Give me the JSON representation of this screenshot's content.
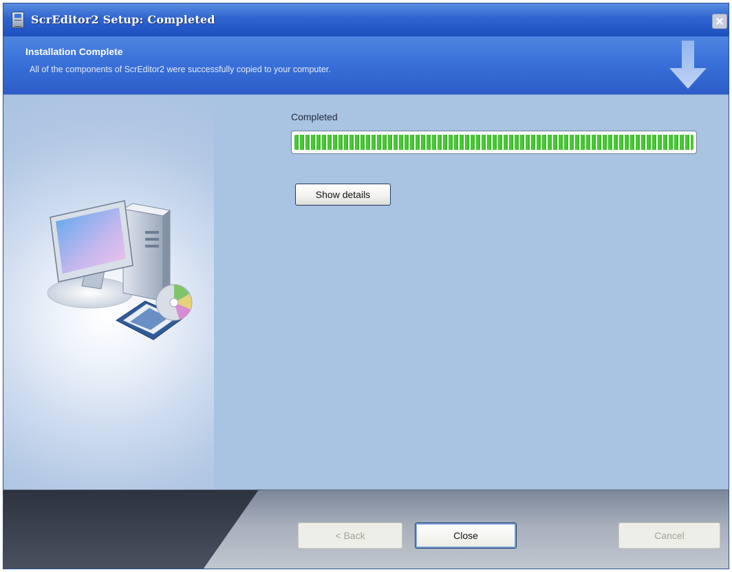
{
  "window": {
    "title": "ScrEditor2 Setup: Completed",
    "icons": {
      "app": "setup-app-icon",
      "close": "close-icon"
    }
  },
  "header": {
    "title": "Installation Complete",
    "subtitle": "All of the components of ScrEditor2 were successfully copied to your computer.",
    "icon": "download-arrow-icon"
  },
  "main": {
    "status_label": "Completed",
    "progress_percent": 100,
    "progress_color": "#3cc12a",
    "show_details_label": "Show details",
    "illustration": "computer-with-cd-illustration"
  },
  "footer": {
    "back_label": "< Back",
    "close_label": "Close",
    "cancel_label": "Cancel"
  },
  "colors": {
    "title_bar": "#2f64cf",
    "header_band": "#3b72da",
    "body_background": "#a9c3e2",
    "footer_background": "#a7afbc"
  }
}
